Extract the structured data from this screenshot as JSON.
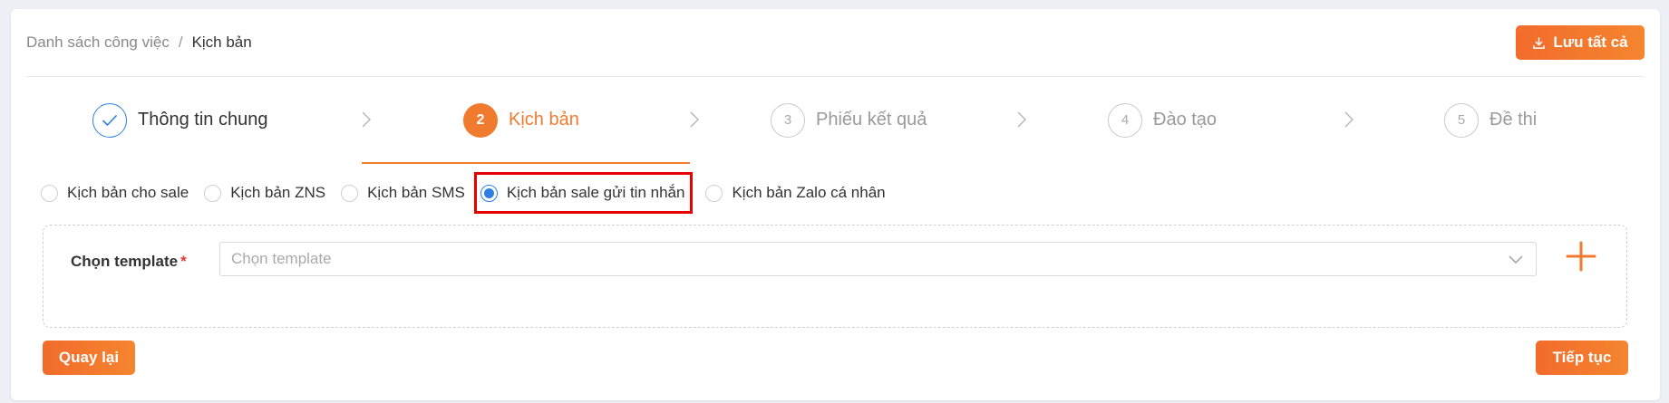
{
  "breadcrumb": {
    "parent": "Danh sách công việc",
    "separator": "/",
    "current": "Kịch bản"
  },
  "header": {
    "save_all_label": "Lưu tất cả",
    "save_icon": "download-icon"
  },
  "steps": [
    {
      "number": "",
      "label": "Thông tin chung",
      "state": "done",
      "icon": "check-icon"
    },
    {
      "number": "2",
      "label": "Kịch bản",
      "state": "active"
    },
    {
      "number": "3",
      "label": "Phiếu kết quả",
      "state": "pending"
    },
    {
      "number": "4",
      "label": "Đào tạo",
      "state": "pending"
    },
    {
      "number": "5",
      "label": "Đề thi",
      "state": "pending"
    }
  ],
  "script_types": {
    "options": [
      {
        "label": "Kịch bản cho sale",
        "checked": false
      },
      {
        "label": "Kịch bản ZNS",
        "checked": false
      },
      {
        "label": "Kịch bản SMS",
        "checked": false
      },
      {
        "label": "Kịch bản sale gửi tin nhắn",
        "checked": true
      },
      {
        "label": "Kịch bản Zalo cá nhân",
        "checked": false
      }
    ]
  },
  "template": {
    "label": "Chọn template",
    "required_mark": "*",
    "placeholder": "Chọn template"
  },
  "footer": {
    "back_label": "Quay lại",
    "next_label": "Tiếp tục"
  },
  "colors": {
    "accent": "#f07b2f",
    "primary_blue": "#2f7fe0",
    "highlight_red": "#e60000"
  }
}
